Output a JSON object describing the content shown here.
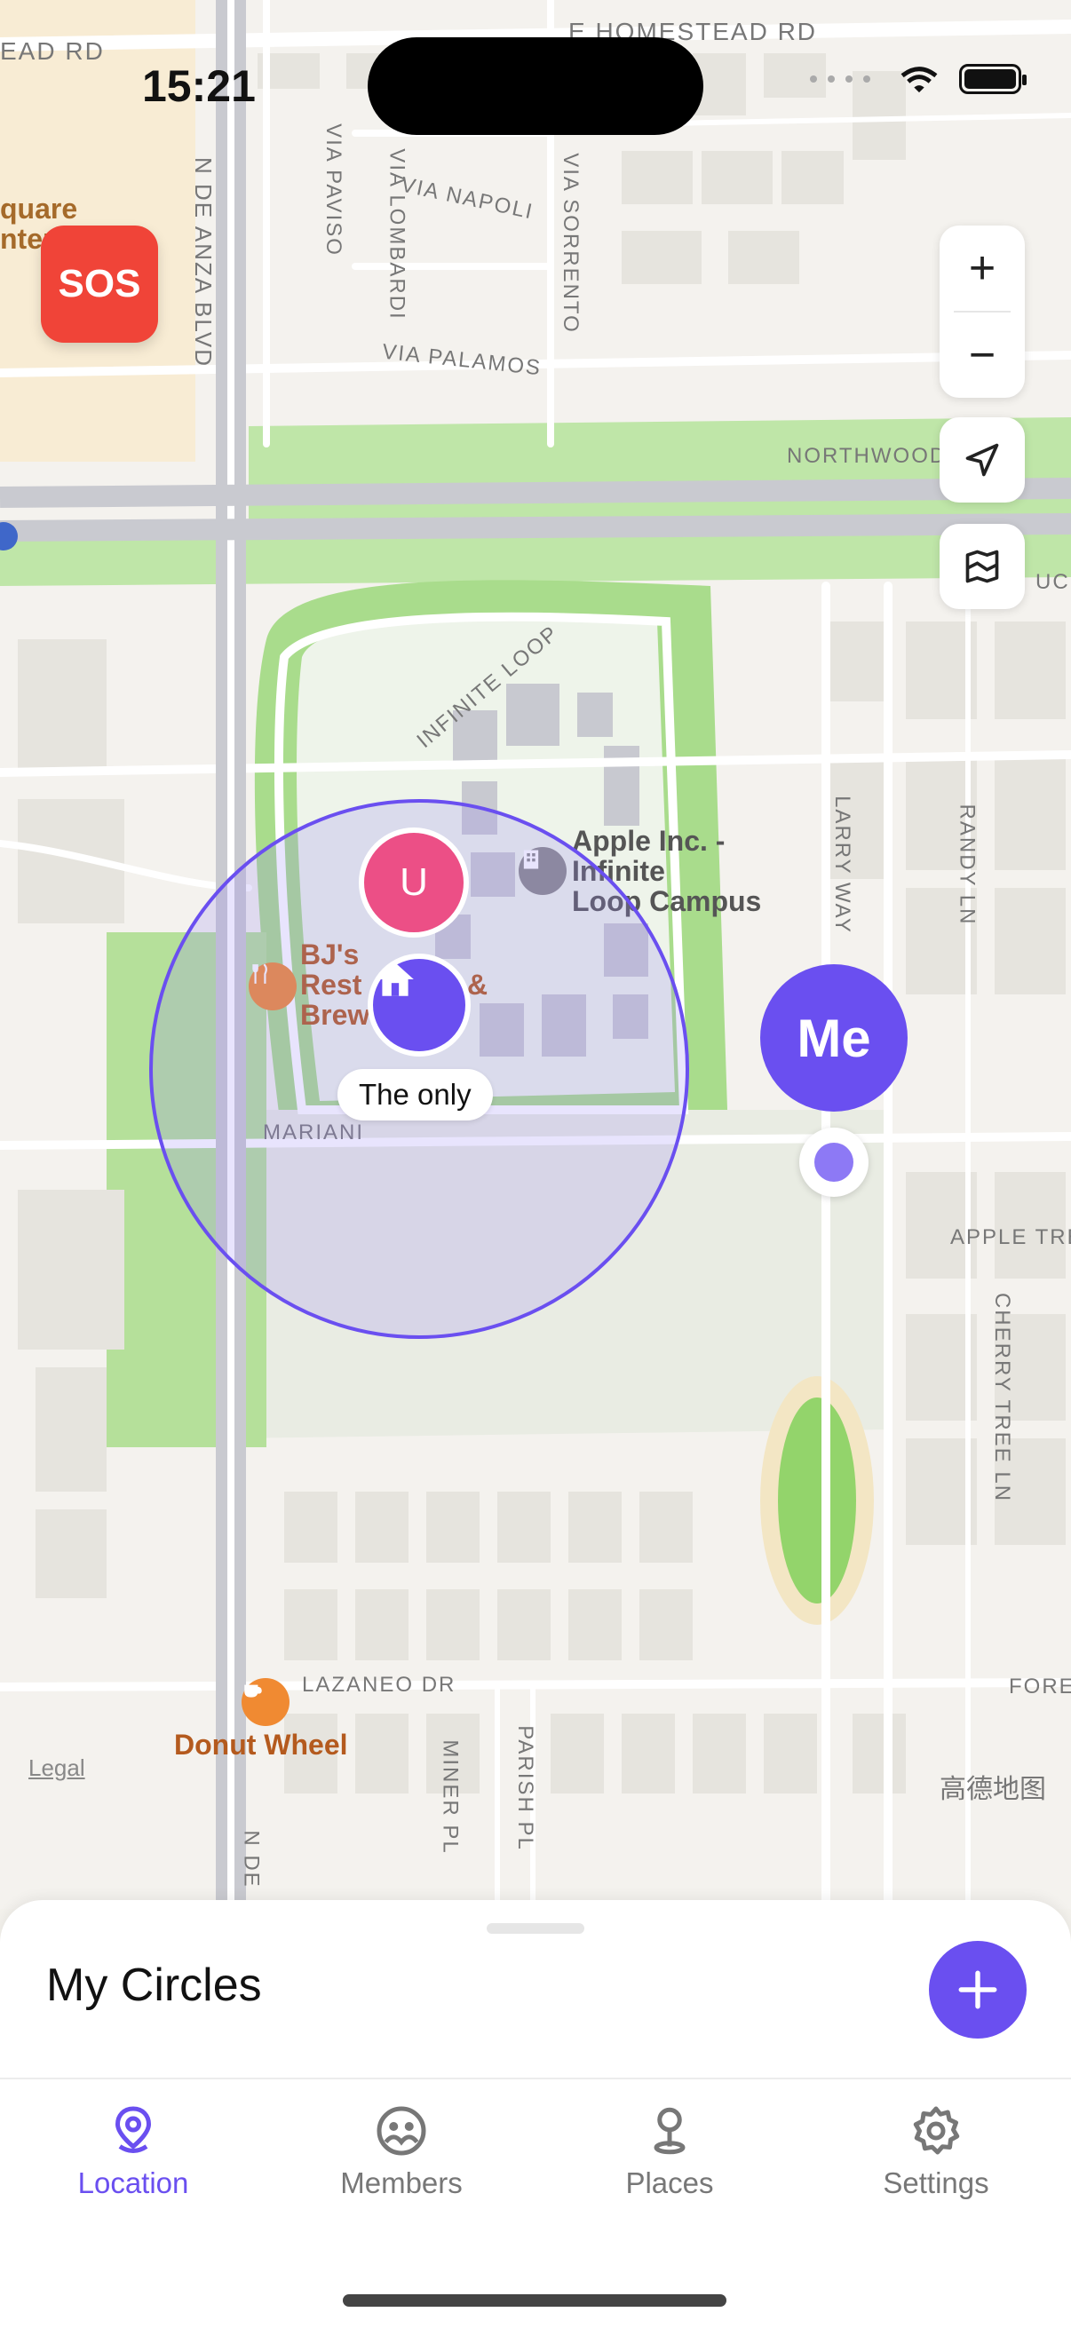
{
  "status_bar": {
    "time": "15:21"
  },
  "map": {
    "streets": {
      "ead_rd": "EAD RD",
      "homestead": "E HOMESTEAD RD",
      "de_anza": "N DE ANZA BLVD",
      "via_paviso": "VIA PAVISO",
      "via_lombardi": "VIA LOMBARDI",
      "via_napoli": "VIA NAPOLI",
      "via_sorrento": "VIA SORRENTO",
      "via_palamos": "VIA PALAMOS",
      "northwood": "NORTHWOOD",
      "infinite_loop": "INFINITE LOOP",
      "larry_way": "LARRY WAY",
      "randy_ln": "RANDY LN",
      "mariani": "MARIANI",
      "apple_tree": "APPLE TRE",
      "cherry_tree": "CHERRY TREE LN",
      "lazaneo": "LAZANEO DR",
      "fore": "FORE",
      "miner_pl": "MINER PL",
      "parish_pl": "PARISH PL",
      "n_de": "N DE",
      "ucil": "UCIL"
    },
    "pois": {
      "square_center": "quare\nnter",
      "apple": "Apple Inc. -\nInfinite\nLoop Campus",
      "bjs": "BJ's\nRest\nBrew",
      "bjs_amp": "&",
      "donut": "Donut Wheel"
    },
    "legal": "Legal",
    "attribution": "高德地图"
  },
  "controls": {
    "sos_label": "SOS",
    "zoom_in": "+",
    "zoom_out": "−"
  },
  "markers": {
    "member_initial": "U",
    "place_name": "The only",
    "me_label": "Me"
  },
  "sheet": {
    "title": "My Circles"
  },
  "tabs": [
    {
      "label": "Location",
      "icon": "location-pin-icon",
      "active": true
    },
    {
      "label": "Members",
      "icon": "members-icon",
      "active": false
    },
    {
      "label": "Places",
      "icon": "places-icon",
      "active": false
    },
    {
      "label": "Settings",
      "icon": "gear-icon",
      "active": false
    }
  ],
  "colors": {
    "accent": "#6a4ff0",
    "sos": "#f04438",
    "member": "#ec4f86"
  }
}
